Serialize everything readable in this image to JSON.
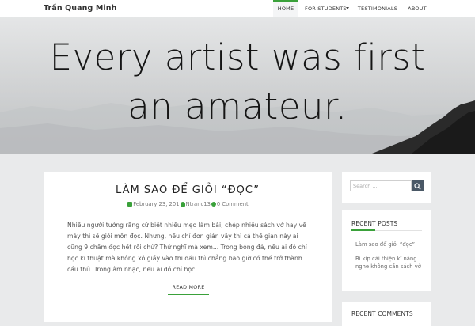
{
  "site": {
    "title": "Trần Quang Minh"
  },
  "nav": {
    "items": [
      {
        "label": "HOME",
        "active": true
      },
      {
        "label": "FOR STUDENTS",
        "has_dropdown": true
      },
      {
        "label": "TESTIMONIALS"
      },
      {
        "label": "ABOUT"
      }
    ]
  },
  "hero": {
    "line1": "Every artist was first",
    "line2": "an amateur."
  },
  "post": {
    "title": "LÀM SAO ĐỂ GIỎI “ĐỌC”",
    "date": "February 23, 201",
    "author": "Ntranc13",
    "comments": "0 Comment",
    "excerpt": "Nhiều người tưởng rằng cứ biết nhiều mẹo làm bài, chép nhiều sách vở hay về máy thì sẽ giỏi môn đọc. Nhưng, nếu chỉ đơn giản vậy thì cả thế gian này ai cũng 9 chấm đọc hết rồi chứ? Thử nghĩ mà xem... Trong bóng đá, nếu ai đó chỉ học kĩ thuật mà không xỏ giầy vào thi đấu thì chẳng bao giờ có thể trở thành cầu thủ. Trong âm nhạc, nếu ai đó chỉ học...",
    "read_more": "READ MORE"
  },
  "sidebar": {
    "search": {
      "placeholder": "Search ..."
    },
    "recent_posts": {
      "title": "RECENT POSTS",
      "items": [
        "Làm sao để giỏi “đọc”",
        "Bí kíp cải thiện kĩ năng nghe không cần sách vở"
      ]
    },
    "recent_comments": {
      "title": "RECENT COMMENTS"
    }
  },
  "colors": {
    "accent": "#3aa13a",
    "search_button": "#4a5866"
  }
}
